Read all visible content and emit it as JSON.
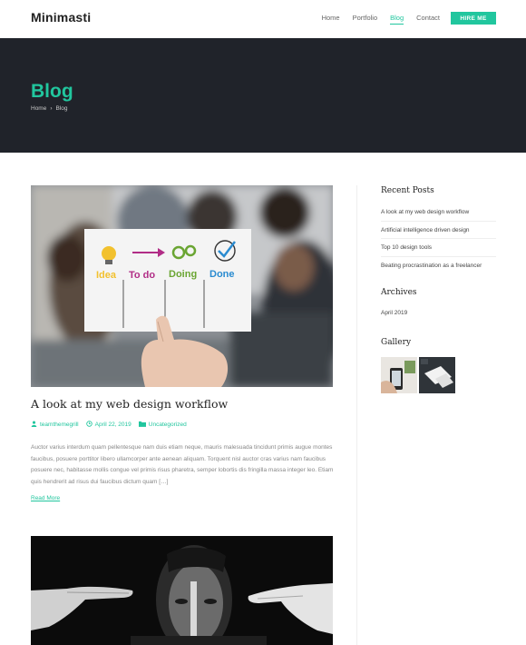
{
  "header": {
    "logo": "Minimasti",
    "nav": [
      "Home",
      "Portfolio",
      "Blog",
      "Contact"
    ],
    "cta": "HIRE ME"
  },
  "banner": {
    "title": "Blog",
    "breadcrumb_home": "Home",
    "breadcrumb_sep": "›",
    "breadcrumb_current": "Blog"
  },
  "post": {
    "title": "A look at my web design workflow",
    "author": "teamthemegrill",
    "date": "April 22, 2019",
    "category": "Uncategorized",
    "excerpt": "Auctor varius interdum quam pellentesque nam duis etiam neque, mauris malesuada tincidunt primis augue montes faucibus, posuere porttitor libero ullamcorper ante aenean aliquam. Torquent nisl auctor cras varius nam faucibus posuere nec, habitasse mollis congue vel primis risus pharetra, semper lobortis dis fringilla massa integer leo. Etiam quis hendrerit ad risus dui faucibus dictum quam […]",
    "read_more": "Read More",
    "image_words": [
      "Idea",
      "To do",
      "Doing",
      "Done"
    ]
  },
  "sidebar": {
    "recent_title": "Recent Posts",
    "recent_posts": [
      "A look at my web design workflow",
      "Artificial intelligence driven design",
      "Top 10 design tools",
      "Beating procrastination as a freelancer"
    ],
    "archives_title": "Archives",
    "archive_item": "April 2019",
    "gallery_title": "Gallery"
  },
  "colors": {
    "accent": "#21c69e",
    "banner_bg": "#20232a"
  },
  "icons": [
    "user-icon",
    "clock-icon",
    "folder-icon"
  ]
}
